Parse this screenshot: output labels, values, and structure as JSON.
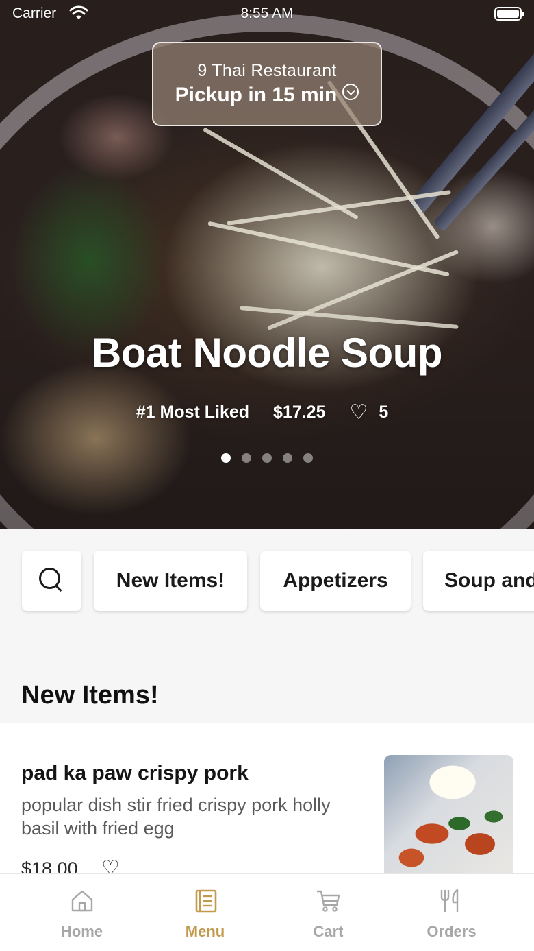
{
  "status_bar": {
    "carrier": "Carrier",
    "time": "8:55 AM"
  },
  "header": {
    "restaurant_name": "9 Thai Restaurant",
    "pickup_text": "Pickup in 15 min"
  },
  "featured": {
    "title": "Boat Noodle Soup",
    "rank_label": "#1 Most Liked",
    "price": "$17.25",
    "likes": "5",
    "carousel_pages": 5,
    "carousel_active_index": 0
  },
  "categories": {
    "search_icon": "search-icon",
    "items": [
      "New Items!",
      "Appetizers",
      "Soup and"
    ]
  },
  "section": {
    "title": "New Items!"
  },
  "menu_items": [
    {
      "name": "pad ka paw crispy pork",
      "description": "popular dish stir fried crispy pork   holly basil with fried egg",
      "price": "$18.00",
      "like_icon": "heart-outline-icon"
    }
  ],
  "tab_bar": {
    "active_color": "#c29a4e",
    "inactive_color": "#a7a7a7",
    "tabs": [
      {
        "label": "Home",
        "icon": "home-icon"
      },
      {
        "label": "Menu",
        "icon": "menu-icon"
      },
      {
        "label": "Cart",
        "icon": "cart-icon"
      },
      {
        "label": "Orders",
        "icon": "utensils-icon"
      }
    ],
    "active_tab": "Menu"
  }
}
